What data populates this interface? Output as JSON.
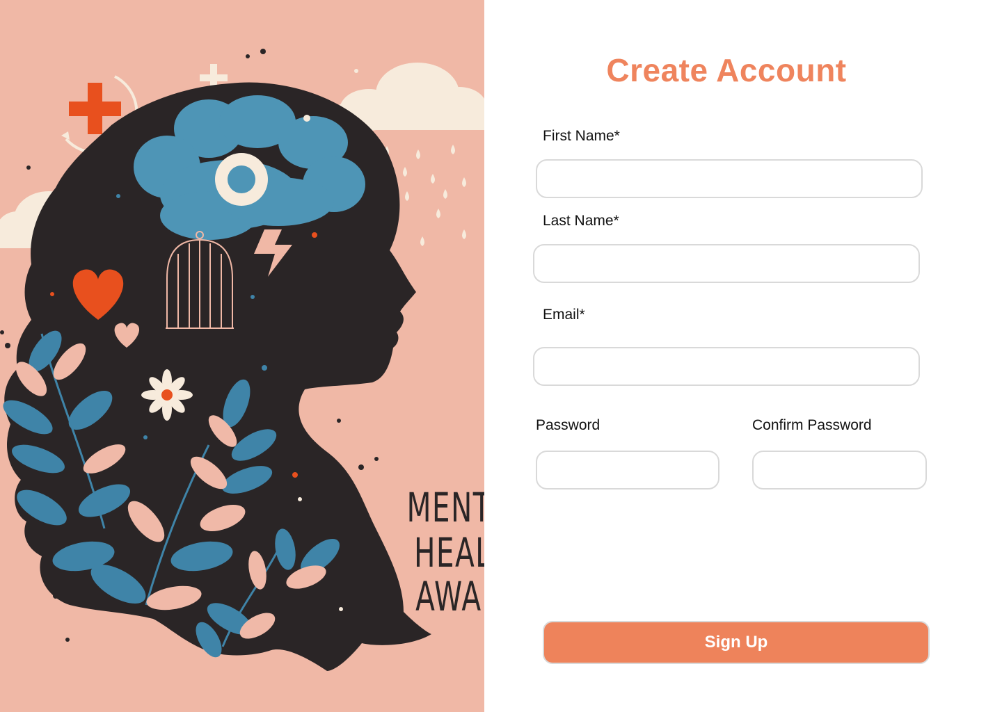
{
  "illustration": {
    "alt": "mental-health-awareness-illustration",
    "poster_text_lines": [
      "MENTAL",
      "HEALTH",
      "AWARE"
    ],
    "colors": {
      "background": "#f0b8a6",
      "silhouette": "#2a2526",
      "brain": "#4e95b6",
      "accent_red": "#e8501e",
      "cream": "#f7ebdc",
      "leaf_blue": "#3f84a8",
      "leaf_pink": "#f0b9a8"
    }
  },
  "form": {
    "title": "Create Account",
    "first_name_label": "First Name*",
    "last_name_label": "Last Name*",
    "email_label": "Email*",
    "password_label": "Password",
    "confirm_password_label": "Confirm Password",
    "first_name_value": "",
    "last_name_value": "",
    "email_value": "",
    "password_value": "",
    "confirm_password_value": "",
    "submit_label": "Sign Up"
  },
  "colors": {
    "accent": "#ee835b",
    "input_border": "#d9d9d9",
    "text": "#111111"
  }
}
